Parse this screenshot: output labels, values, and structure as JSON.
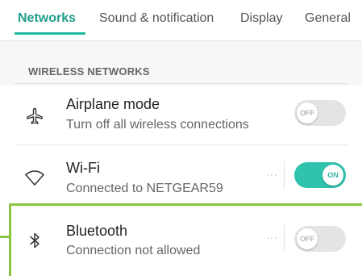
{
  "tabs": [
    {
      "label": "Networks",
      "active": true
    },
    {
      "label": "Sound & notification",
      "active": false
    },
    {
      "label": "Display",
      "active": false
    },
    {
      "label": "General",
      "active": false
    }
  ],
  "section": {
    "header": "WIRELESS NETWORKS"
  },
  "rows": [
    {
      "icon": "airplane-icon",
      "title": "Airplane mode",
      "subtitle": "Turn off all wireless connections",
      "toggle": {
        "state": "off",
        "label": "OFF"
      }
    },
    {
      "icon": "wifi-icon",
      "title": "Wi-Fi",
      "subtitle": "Connected to NETGEAR59",
      "more": "···",
      "toggle": {
        "state": "on",
        "label": "ON"
      }
    },
    {
      "icon": "bluetooth-icon",
      "title": "Bluetooth",
      "subtitle": "Connection not allowed",
      "more": "···",
      "toggle": {
        "state": "off",
        "label": "OFF"
      }
    }
  ],
  "colors": {
    "accent": "#1fb8a0",
    "toggle_on": "#2fc3ad",
    "toggle_off": "#e4e4e4",
    "highlight": "#8cc63f"
  }
}
